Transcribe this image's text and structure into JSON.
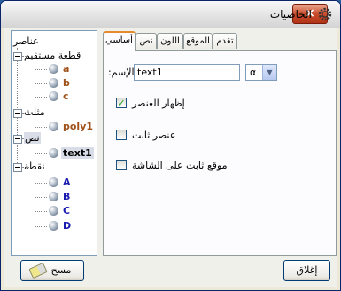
{
  "window": {
    "title": "الخاصيات",
    "close_label": "×"
  },
  "tree": {
    "root": "عناصر",
    "groups": [
      {
        "label": "قطعة مستقيم",
        "items": [
          "a",
          "b",
          "c"
        ],
        "color": "#a0521b"
      },
      {
        "label": "مثلث",
        "items": [
          "poly1"
        ],
        "color": "#a0521b"
      },
      {
        "label": "نص",
        "items": [
          "text1"
        ],
        "color": "#000000"
      },
      {
        "label": "نقطة",
        "items": [
          "A",
          "B",
          "C",
          "D"
        ],
        "color": "#1a1ab0"
      }
    ]
  },
  "tabs": [
    "أساسي",
    "نص",
    "اللون",
    "الموقع",
    "تقدم"
  ],
  "basic": {
    "name_label": "الإسم:",
    "name_value": "text1",
    "alpha_symbol": "α",
    "dropdown_arrow": "▼",
    "show_object": {
      "label": "إظهار العنصر",
      "checked": true,
      "mark": "✓"
    },
    "fix_object": {
      "label": "عنصر ثابت",
      "checked": false
    },
    "abs_position": {
      "label": "موقع ثابت على الشاشة",
      "checked": false
    }
  },
  "buttons": {
    "delete": "مسح",
    "close": "إغلاق"
  },
  "colors": {
    "title_accent": "#e68b2c",
    "point": "#1a1ab0",
    "segment": "#a0521b"
  }
}
